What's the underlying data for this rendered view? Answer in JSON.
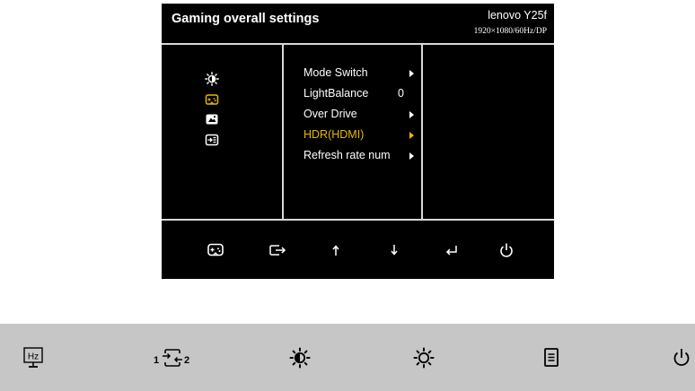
{
  "osd": {
    "title": "Gaming overall settings",
    "model": "lenovo Y25f",
    "resolution": "1920×1080/60Hz/DP",
    "categories": [
      "brightness-icon",
      "gamepad-icon",
      "picture-icon",
      "input-source-icon"
    ],
    "menu": [
      {
        "label": "Mode Switch",
        "value": "",
        "arrow": true,
        "active": false
      },
      {
        "label": "LightBalance",
        "value": "0",
        "arrow": false,
        "active": false
      },
      {
        "label": "Over Drive",
        "value": "",
        "arrow": true,
        "active": false
      },
      {
        "label": "HDR(HDMI)",
        "value": "",
        "arrow": true,
        "active": true
      },
      {
        "label": "Refresh rate num",
        "value": "",
        "arrow": true,
        "active": false
      }
    ],
    "footer_keys": [
      "gamepad-icon",
      "exit-icon",
      "up-arrow-icon",
      "down-arrow-icon",
      "enter-icon",
      "power-icon"
    ],
    "colors": {
      "background": "#000000",
      "divider": "#d8d8d8",
      "active": "#e6b800",
      "text": "#ffffff"
    }
  },
  "button_bar": {
    "keys": [
      {
        "icon": "refresh-rate-icon",
        "label": "Hz"
      },
      {
        "icon": "input-switch-icon",
        "label_left": "1",
        "label_right": "2"
      },
      {
        "icon": "brightness-contrast-icon"
      },
      {
        "icon": "brightness-icon"
      },
      {
        "icon": "menu-icon"
      },
      {
        "icon": "power-icon"
      }
    ],
    "colors": {
      "background": "#c6c6c6",
      "icon": "#000000"
    }
  }
}
